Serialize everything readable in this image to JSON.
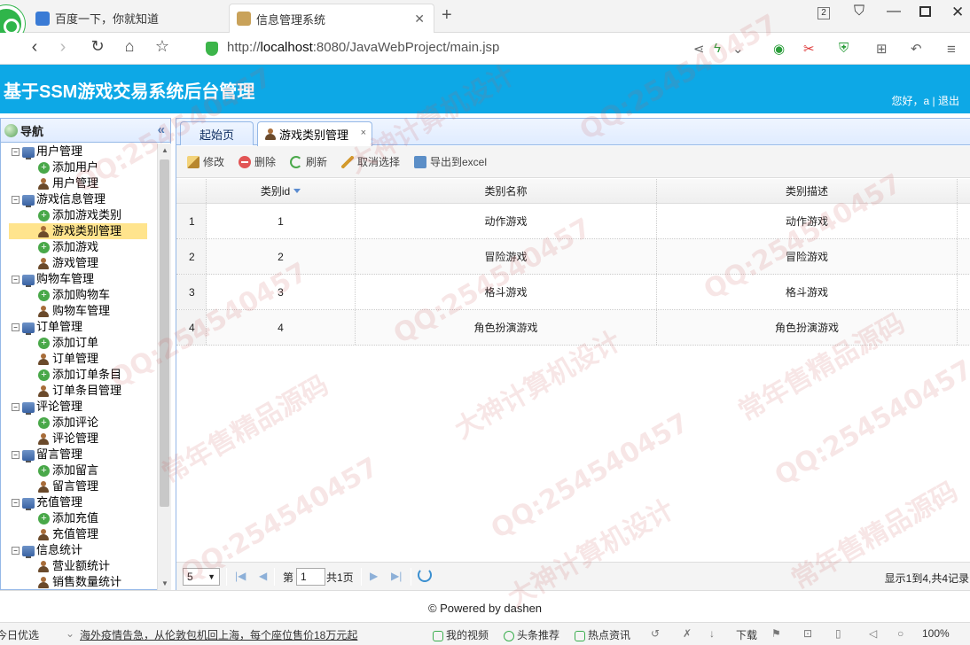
{
  "browser": {
    "tabs": [
      {
        "label": "百度一下，你就知道",
        "icon": "baidu-paw-icon"
      },
      {
        "label": "信息管理系统",
        "icon": "page-favicon-icon"
      }
    ],
    "tab_count": "2",
    "url_prefix": "http://",
    "url_host": "localhost",
    "url_rest": ":8080/JavaWebProject/main.jsp"
  },
  "app": {
    "title": "基于SSM游戏交易系统后台管理",
    "greeting": "您好，a | 退出",
    "accent": "#0da8e6"
  },
  "nav": {
    "title": "导航",
    "collapse": "«",
    "groups": [
      {
        "label": "用户管理",
        "items": [
          "添加用户",
          "用户管理"
        ]
      },
      {
        "label": "游戏信息管理",
        "items": [
          "添加游戏类别",
          "游戏类别管理",
          "添加游戏",
          "游戏管理"
        ]
      },
      {
        "label": "购物车管理",
        "items": [
          "添加购物车",
          "购物车管理"
        ]
      },
      {
        "label": "订单管理",
        "items": [
          "添加订单",
          "订单管理",
          "添加订单条目",
          "订单条目管理"
        ]
      },
      {
        "label": "评论管理",
        "items": [
          "添加评论",
          "评论管理"
        ]
      },
      {
        "label": "留言管理",
        "items": [
          "添加留言",
          "留言管理"
        ]
      },
      {
        "label": "充值管理",
        "items": [
          "添加充值",
          "充值管理"
        ]
      },
      {
        "label": "信息统计",
        "items": [
          "营业额统计",
          "销售数量统计"
        ]
      }
    ],
    "selected": "游戏类别管理"
  },
  "main": {
    "tabs": [
      {
        "label": "起始页"
      },
      {
        "label": "游戏类别管理",
        "close": "×"
      }
    ],
    "toolbar": {
      "edit": "修改",
      "delete": "删除",
      "refresh": "刷新",
      "cancel_select": "取消选择",
      "export": "导出到excel"
    },
    "grid": {
      "columns": [
        "类别id",
        "类别名称",
        "类别描述"
      ],
      "rows": [
        {
          "n": "1",
          "id": "1",
          "name": "动作游戏",
          "desc": "动作游戏"
        },
        {
          "n": "2",
          "id": "2",
          "name": "冒险游戏",
          "desc": "冒险游戏"
        },
        {
          "n": "3",
          "id": "3",
          "name": "格斗游戏",
          "desc": "格斗游戏"
        },
        {
          "n": "4",
          "id": "4",
          "name": "角色扮演游戏",
          "desc": "角色扮演游戏"
        }
      ]
    },
    "pager": {
      "page_size": "5",
      "page_label": "第",
      "page_value": "1",
      "total_pages": "共1页",
      "info": "显示1到4,共4记录"
    }
  },
  "footer": {
    "text": "© Powered by dashen"
  },
  "statusbar": {
    "left": "今日优选",
    "news": "海外疫情告急，从伦敦包机回上海，每个座位售价18万元起",
    "video": "我的视频",
    "headline": "头条推荐",
    "hot": "热点资讯",
    "download": "下载",
    "zoom": "100%"
  },
  "watermarks": [
    "QQ:254540457",
    "常年售精品源码",
    "大神计算机设计"
  ]
}
